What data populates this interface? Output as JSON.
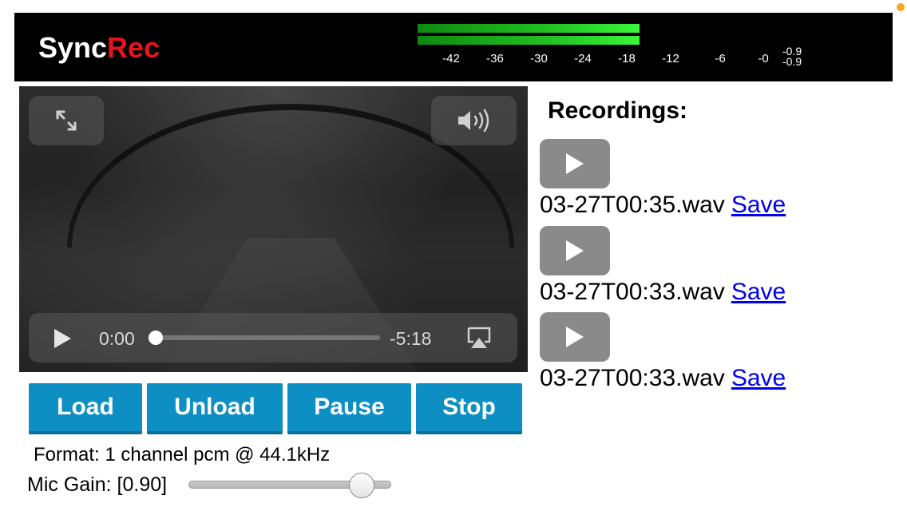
{
  "app": {
    "logo_part1": "Sync",
    "logo_part2": "Rec"
  },
  "meter": {
    "ticks": [
      "-42",
      "-36",
      "-30",
      "-24",
      "-18",
      "-12",
      "-6",
      "-0"
    ],
    "peak_top": "-0.9",
    "peak_bottom": "-0.9",
    "colors": {
      "bar_dark": "#0e8a0e",
      "bar_light": "#39f739"
    }
  },
  "player": {
    "current_time": "0:00",
    "remaining_time": "-5:18",
    "progress": 0.0
  },
  "transport": {
    "load": "Load",
    "unload": "Unload",
    "pause": "Pause",
    "stop": "Stop",
    "button_color": "#0e8fc4"
  },
  "format": {
    "text": "Format: 1 channel pcm @ 44.1kHz"
  },
  "mic_gain": {
    "label": "Mic Gain: [0.90]",
    "value": 0.9
  },
  "recordings": {
    "heading": "Recordings:",
    "items": [
      {
        "filename": "03-27T00:35.wav",
        "save_label": "Save"
      },
      {
        "filename": "03-27T00:33.wav",
        "save_label": "Save"
      },
      {
        "filename": "03-27T00:33.wav",
        "save_label": "Save"
      }
    ]
  },
  "icons": {
    "fullscreen": "expand-arrows-icon",
    "volume": "speaker-icon",
    "play": "play-icon",
    "airplay": "airplay-icon"
  }
}
